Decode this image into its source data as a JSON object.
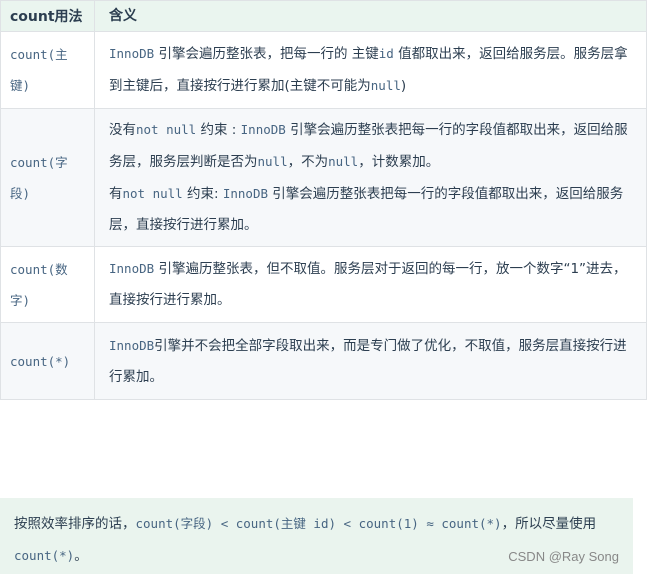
{
  "table": {
    "headers": [
      "count用法",
      "含义"
    ],
    "rows": [
      {
        "usage": "count(主键)",
        "meaning": [
          [
            {
              "t": "InnoDB",
              "code": true
            },
            {
              "t": " 引擎会遍历整张表，把每一行的 主键"
            },
            {
              "t": "id",
              "code": true
            },
            {
              "t": " 值都取出来，返回给服务层。服务层拿到主键后，直接按行进行累加(主键不可能为"
            },
            {
              "t": "null",
              "code": true
            },
            {
              "t": ")"
            }
          ]
        ]
      },
      {
        "usage": "count(字段)",
        "meaning": [
          [
            {
              "t": "没有"
            },
            {
              "t": "not null",
              "code": true
            },
            {
              "t": " 约束 : "
            },
            {
              "t": "InnoDB",
              "code": true
            },
            {
              "t": " 引擎会遍历整张表把每一行的字段值都取出来，返回给服务层，服务层判断是否为"
            },
            {
              "t": "null",
              "code": true
            },
            {
              "t": "，不为"
            },
            {
              "t": "null",
              "code": true
            },
            {
              "t": "，计数累加。"
            }
          ],
          [
            {
              "t": "有"
            },
            {
              "t": "not null",
              "code": true
            },
            {
              "t": " 约束: "
            },
            {
              "t": "InnoDB",
              "code": true
            },
            {
              "t": " 引擎会遍历整张表把每一行的字段值都取出来，返回给服务层，直接按行进行累加。"
            }
          ]
        ]
      },
      {
        "usage": "count(数字)",
        "meaning": [
          [
            {
              "t": "InnoDB",
              "code": true
            },
            {
              "t": " 引擎遍历整张表，但不取值。服务层对于返回的每一行，放一个数字“1”进去，直接按行进行累加。"
            }
          ]
        ]
      },
      {
        "usage": "count(*)",
        "meaning": [
          [
            {
              "t": "InnoDB",
              "code": true
            },
            {
              "t": "引擎并不会把全部字段取出来，而是专门做了优化，不取值，服务层直接按行进行累加。"
            }
          ]
        ]
      }
    ]
  },
  "tip": [
    {
      "t": "按照效率排序的话，"
    },
    {
      "t": "count(字段) < count(主键 id) < count(1) ≈ count(*)",
      "code": true
    },
    {
      "t": "，所以尽量使用 "
    },
    {
      "t": "count(*)",
      "code": true
    },
    {
      "t": "。"
    }
  ],
  "watermark": "CSDN @Ray Song"
}
